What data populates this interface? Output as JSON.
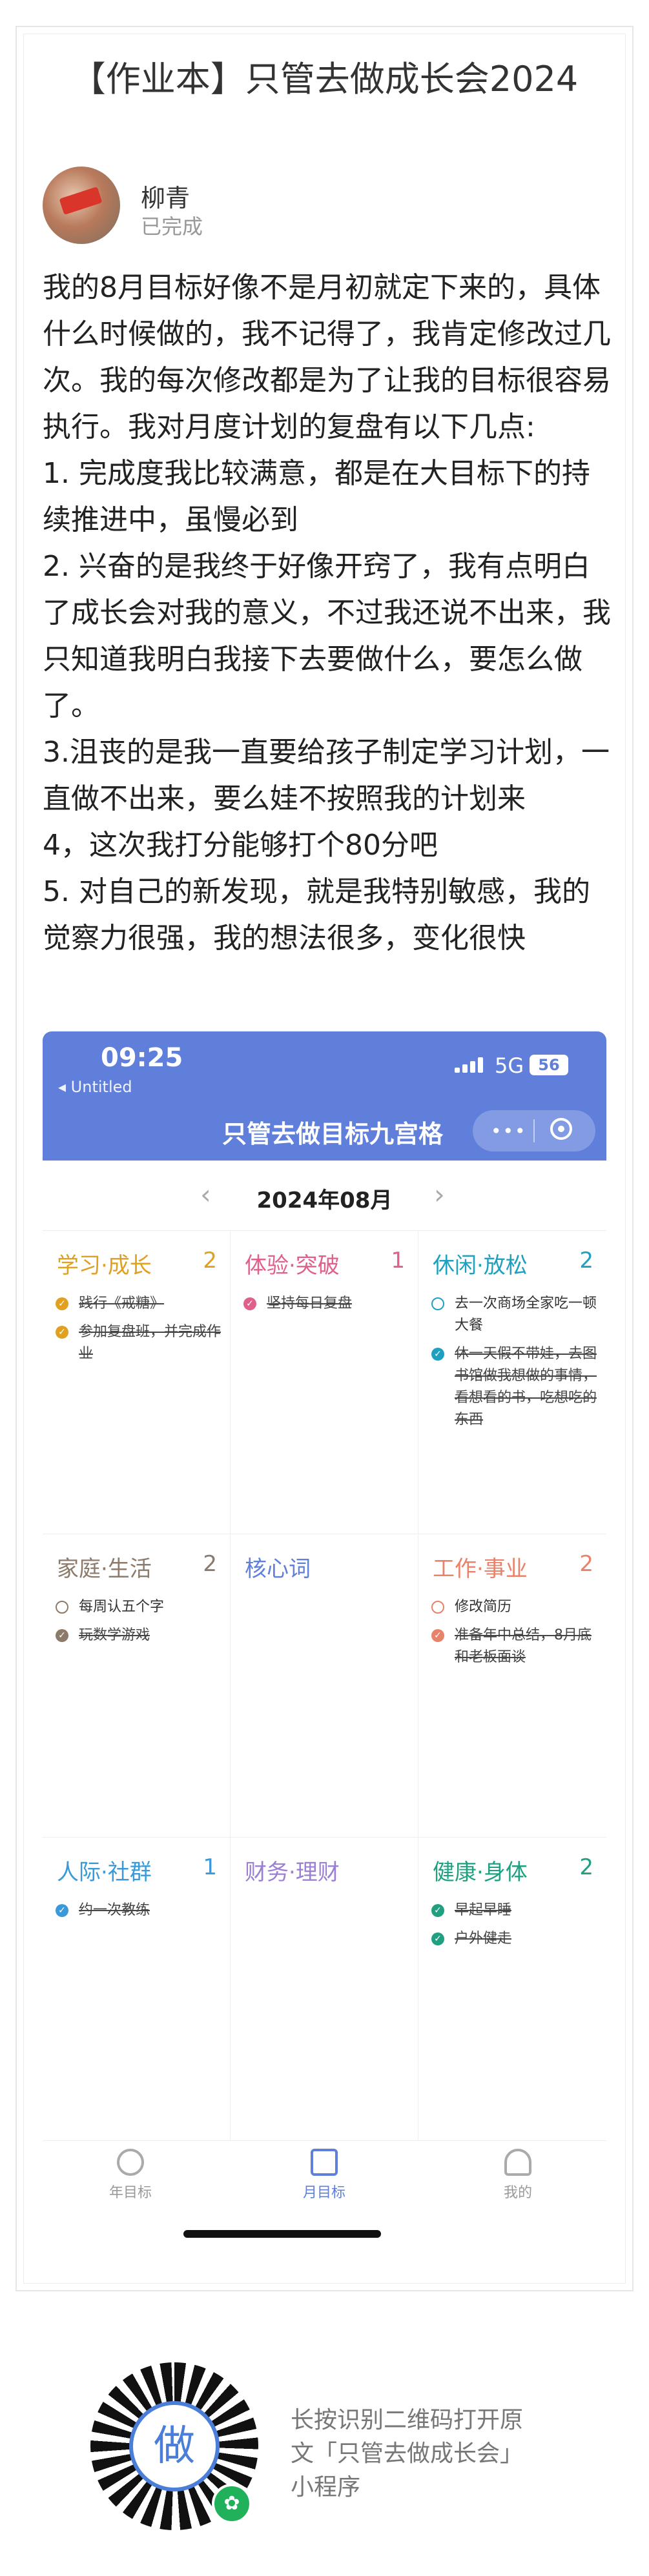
{
  "doc_title": "【作业本】只管去做成长会2024",
  "author": {
    "name": "柳青",
    "status": "已完成"
  },
  "body": [
    "我的8月目标好像不是月初就定下来的，具体什么时候做的，我不记得了，我肯定修改过几次。我的每次修改都是为了让我的目标很容易执行。我对月度计划的复盘有以下几点:",
    "1. 完成度我比较满意，都是在大目标下的持续推进中，虽慢必到",
    "2. 兴奋的是我终于好像开窍了，我有点明白了成长会对我的意义，不过我还说不出来，我只知道我明白我接下去要做什么，要怎么做了。",
    "3.沮丧的是我一直要给孩子制定学习计划，一直做不出来，要么娃不按照我的计划来",
    "4，这次我打分能够打个80分吧",
    "5. 对自己的新发现，就是我特别敏感，我的觉察力很强，我的想法很多，变化很快"
  ],
  "phone": {
    "status_time": "09:25",
    "back_label": "◂ Untitled",
    "network": "5G",
    "battery": "56",
    "app_title": "只管去做目标九宫格",
    "capsule_dots": "•••",
    "month": "2024年08月",
    "prev": "‹",
    "next": "›",
    "cells": [
      {
        "title": "学习·成长",
        "count": "2",
        "color": "#e0a020",
        "tasks": [
          {
            "text": "践行《戒糖》",
            "done": true
          },
          {
            "text": "参加复盘班，并完成作业",
            "done": true
          }
        ]
      },
      {
        "title": "体验·突破",
        "count": "1",
        "color": "#e0608a",
        "tasks": [
          {
            "text": "坚持每日复盘",
            "done": true
          }
        ]
      },
      {
        "title": "休闲·放松",
        "count": "2",
        "color": "#20a0c0",
        "tasks": [
          {
            "text": "去一次商场全家吃一顿大餐",
            "done": false
          },
          {
            "text": "休一天假不带娃，去图书馆做我想做的事情，看想看的书，吃想吃的东西",
            "done": true
          }
        ]
      },
      {
        "title": "家庭·生活",
        "count": "2",
        "color": "#8c7a6b",
        "tasks": [
          {
            "text": "每周认五个字",
            "done": false
          },
          {
            "text": "玩数学游戏",
            "done": true
          }
        ]
      },
      {
        "title": "核心词",
        "count": "",
        "color": "#5f7fdb",
        "tasks": []
      },
      {
        "title": "工作·事业",
        "count": "2",
        "color": "#e8826a",
        "tasks": [
          {
            "text": "修改简历",
            "done": false
          },
          {
            "text": "准备年中总结，8月底和老板面谈",
            "done": true
          }
        ]
      },
      {
        "title": "人际·社群",
        "count": "1",
        "color": "#3a9ad9",
        "tasks": [
          {
            "text": "约一次教练",
            "done": true
          }
        ]
      },
      {
        "title": "财务·理财",
        "count": "",
        "color": "#9b7fd4",
        "tasks": []
      },
      {
        "title": "健康·身体",
        "count": "2",
        "color": "#20a080",
        "tasks": [
          {
            "text": "早起早睡",
            "done": true
          },
          {
            "text": "户外健走",
            "done": true
          }
        ]
      }
    ],
    "tabs": [
      {
        "label": "年目标",
        "icon": "target-icon"
      },
      {
        "label": "月目标",
        "icon": "calendar-icon"
      },
      {
        "label": "我的",
        "icon": "user-icon"
      }
    ],
    "active_tab": 1
  },
  "footer": {
    "qr_icon": "qr-code-icon",
    "qr_center_glyph": "做",
    "badge_glyph": "✿",
    "lines": [
      "长按识别二维码打开原",
      "文「只管去做成长会」",
      "小程序"
    ]
  }
}
